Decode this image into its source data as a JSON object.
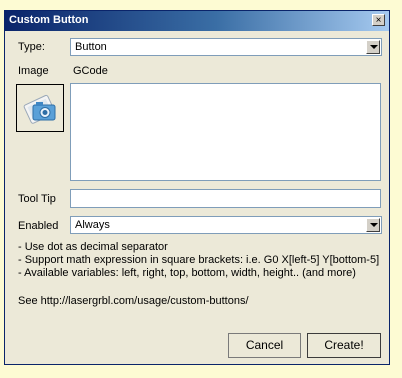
{
  "window": {
    "title": "Custom Button",
    "close_glyph": "×"
  },
  "type_field": {
    "label": "Type:",
    "value": "Button"
  },
  "image_field": {
    "label": "Image",
    "icon": "camera-picture-icon"
  },
  "gcode_field": {
    "label": "GCode",
    "value": ""
  },
  "tooltip_field": {
    "label": "Tool Tip",
    "value": ""
  },
  "enabled_field": {
    "label": "Enabled",
    "value": "Always"
  },
  "info_lines": [
    "- Use dot as decimal separator",
    "- Support math expression in square brackets: i.e. G0 X[left-5] Y[bottom-5]",
    "- Available variables: left, right, top, bottom, width, height.. (and more)"
  ],
  "help_link": "See http://lasergrbl.com/usage/custom-buttons/",
  "buttons": {
    "cancel": "Cancel",
    "create": "Create!"
  }
}
